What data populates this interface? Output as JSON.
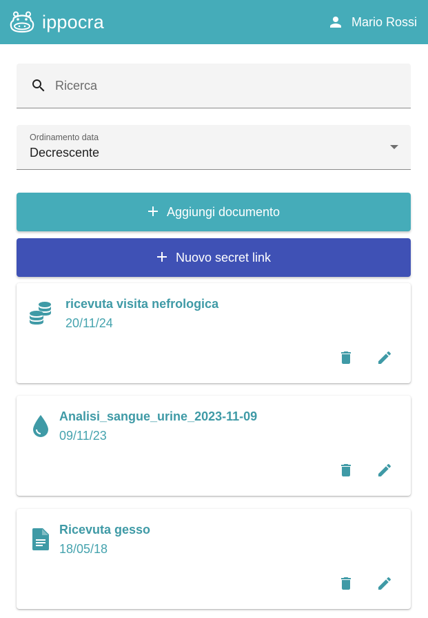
{
  "header": {
    "app_name": "ippocra",
    "user_name": "Mario Rossi"
  },
  "search": {
    "placeholder": "Ricerca"
  },
  "sort": {
    "label": "Ordinamento data",
    "value": "Decrescente"
  },
  "buttons": {
    "add_document": "Aggiungi documento",
    "new_secret_link": "Nuovo secret link"
  },
  "documents": [
    {
      "title": "ricevuta visita nefrologica",
      "date": "20/11/24",
      "icon": "coins-icon"
    },
    {
      "title": "Analisi_sangue_urine_2023-11-09",
      "date": "09/11/23",
      "icon": "drop-icon"
    },
    {
      "title": "Ricevuta gesso",
      "date": "18/05/18",
      "icon": "file-icon"
    }
  ],
  "colors": {
    "primary": "#45acb9",
    "secondary": "#3f51b5",
    "accent_text": "#3f9aa6"
  }
}
